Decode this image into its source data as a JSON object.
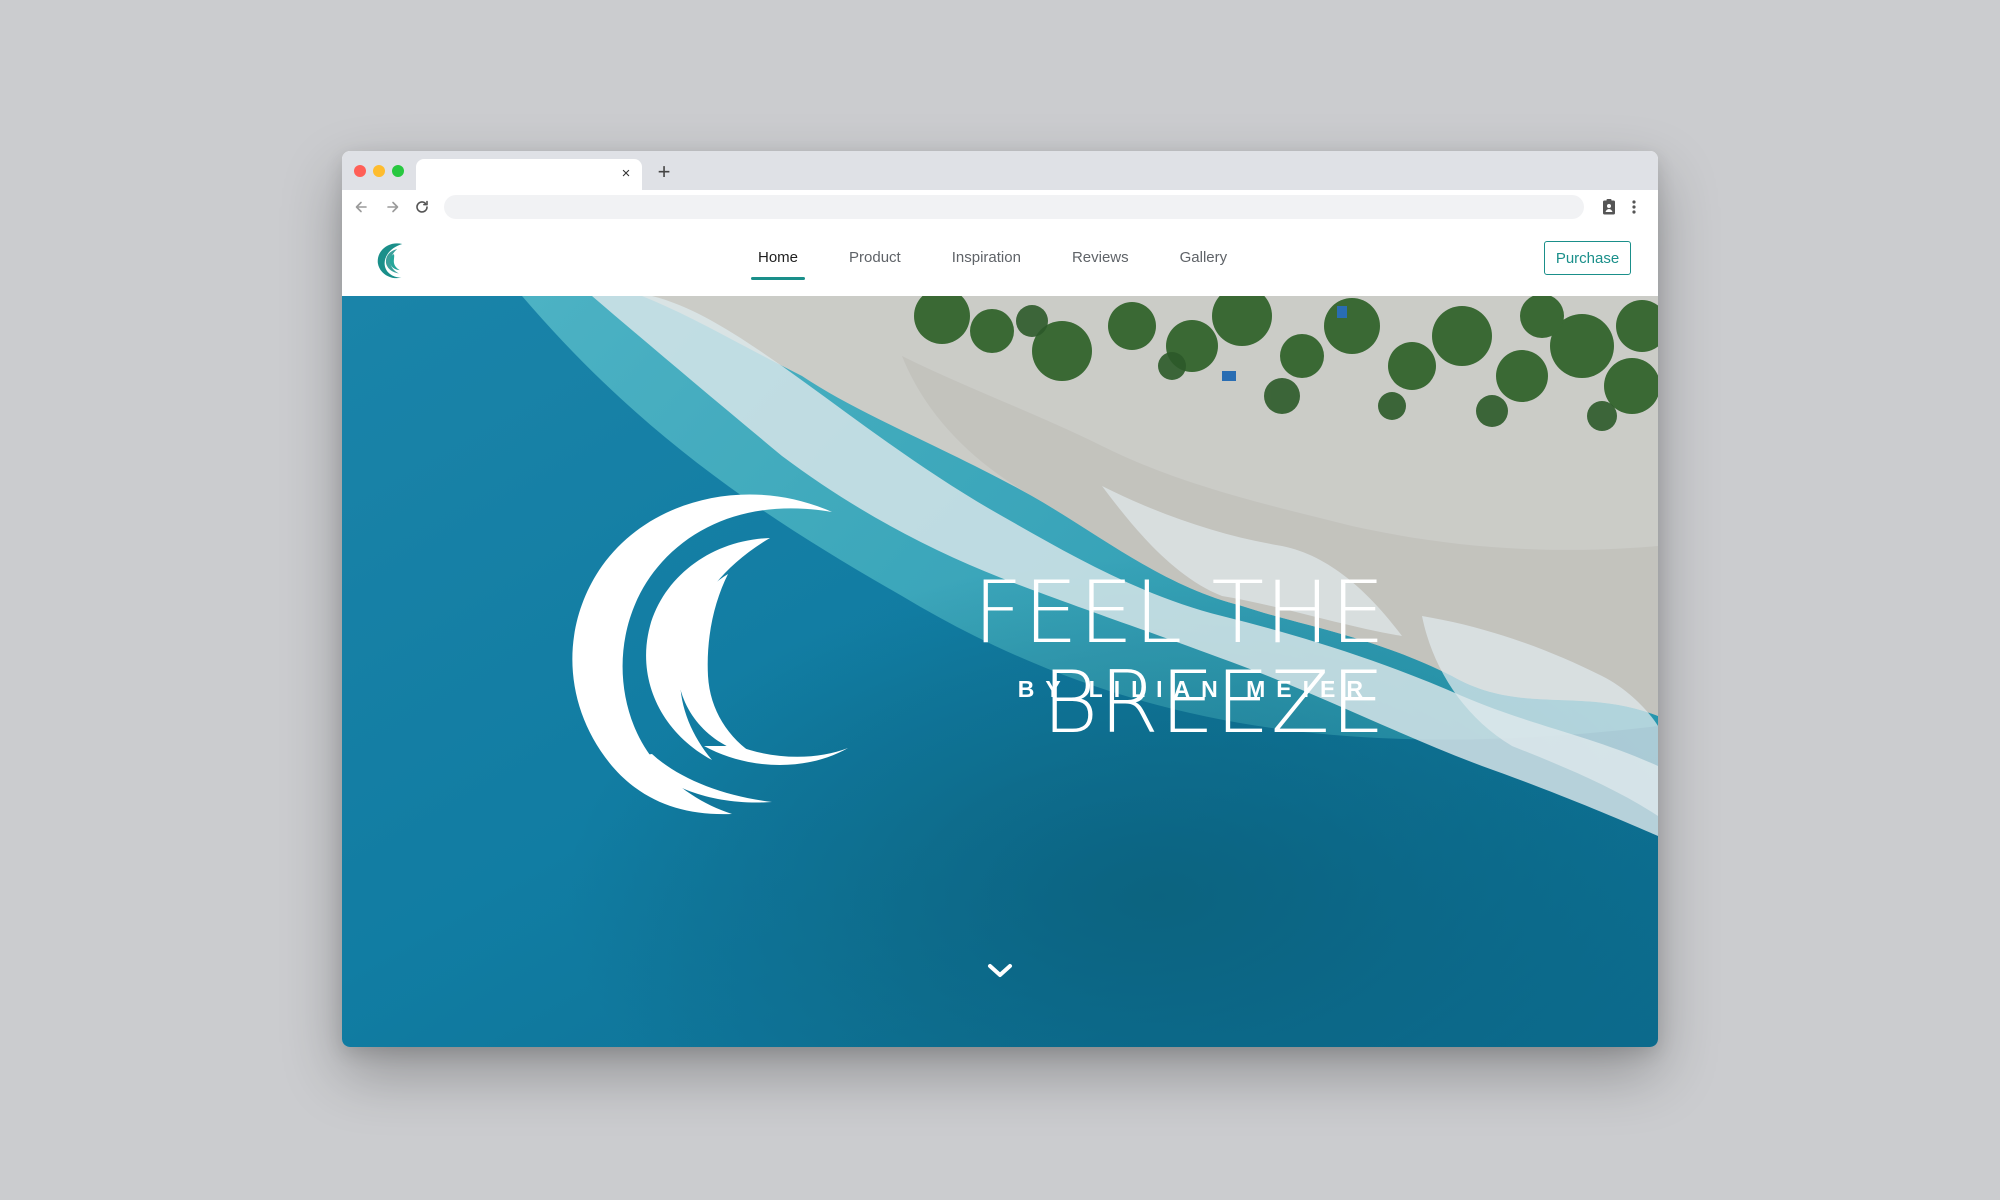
{
  "browser": {
    "tab": {
      "title": "",
      "close_glyph": "×"
    },
    "newtab_glyph": "+",
    "omnibox": {
      "value": "",
      "placeholder": ""
    },
    "icons": {
      "back": "arrow-left-icon",
      "forward": "arrow-right-icon",
      "reload": "reload-icon",
      "extension": "clipboard-profile-icon",
      "menu": "more-vertical-icon"
    }
  },
  "site": {
    "logo_icon": "wave-logo-icon",
    "nav": [
      {
        "label": "Home",
        "active": true
      },
      {
        "label": "Product",
        "active": false
      },
      {
        "label": "Inspiration",
        "active": false
      },
      {
        "label": "Reviews",
        "active": false
      },
      {
        "label": "Gallery",
        "active": false
      }
    ],
    "cta_label": "Purchase"
  },
  "hero": {
    "title": "FEEL THE BREEZE",
    "subtitle": "BY LILIAN MEIER",
    "scroll_icon": "chevron-down-icon"
  },
  "colors": {
    "accent": "#1a8f8a",
    "ocean_deep": "#0e6f95",
    "ocean_shallow": "#3ab1bf",
    "sand": "#dcd6ce",
    "foliage": "#3e6b2e",
    "desktop_bg": "#cbcccf"
  }
}
